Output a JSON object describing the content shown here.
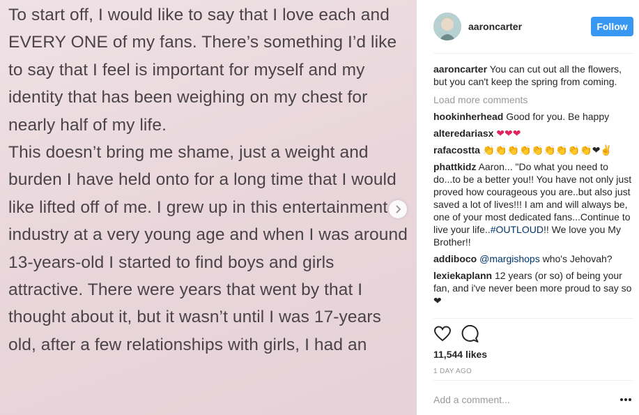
{
  "image": {
    "paragraphs": [
      "To start off, I would like to say that I love each and EVERY ONE of my fans. There’s something I’d like to say that I feel is important for myself and my identity that has been weighing on my chest for nearly half of my life.",
      "This doesn’t bring me shame, just a weight and burden I have held onto for a long time that I would like lifted off of me. I grew up in this entertainment industry at a very young age and when I was around 13-years-old I started to find boys and girls attractive. There were years that went by that I thought about it, but it wasn’t until I was 17-years old, after a few relationships with girls, I had an"
    ],
    "next_icon": "chevron-right-icon"
  },
  "header": {
    "username": "aaroncarter",
    "follow_label": "Follow",
    "accent_color": "#3897f0"
  },
  "caption": {
    "username": "aaroncarter",
    "text": "You can cut out all the flowers, but you can't keep the spring from coming."
  },
  "load_more_label": "Load more comments",
  "comments": [
    {
      "username": "hookinherhead",
      "text": "Good for you. Be happy"
    },
    {
      "username": "alteredariasx",
      "text": "❤❤❤"
    },
    {
      "username": "rafacostta",
      "text": "👏👏👏👏👏👏👏👏👏❤✌"
    },
    {
      "username": "phattkidz",
      "text": "Aaron... \"Do what you need to do...to be a better you!! You have not only just proved how courageous you are..but also just saved a lot of lives!!! I am and will always be, one of your most dedicated fans...Continue to live your life..",
      "hashtag": "#OUTLOUD",
      "text_after": "!! We love you My Brother!!"
    },
    {
      "username": "addiboco",
      "mention": "@margishops",
      "text": "who's Jehovah?"
    },
    {
      "username": "lexiekaplann",
      "text": "12 years (or so) of being your fan, and i've never been more proud to say so❤"
    }
  ],
  "actions": {
    "like_icon": "heart-icon",
    "comment_icon": "comment-bubble-icon",
    "likes": "11,544 likes",
    "time": "1 DAY AGO"
  },
  "comment_box": {
    "placeholder": "Add a comment...",
    "more_icon": "more-options-icon"
  }
}
